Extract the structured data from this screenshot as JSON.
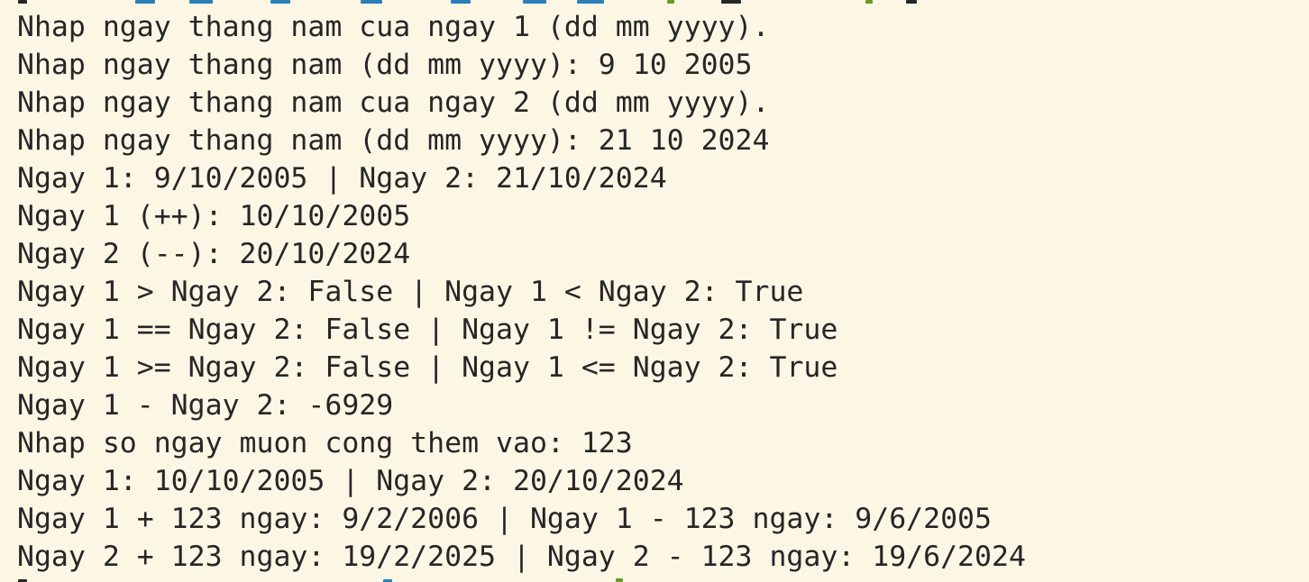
{
  "terminal": {
    "lines": [
      "Nhap ngay thang nam cua ngay 1 (dd mm yyyy).",
      "Nhap ngay thang nam (dd mm yyyy): 9 10 2005",
      "Nhap ngay thang nam cua ngay 2 (dd mm yyyy).",
      "Nhap ngay thang nam (dd mm yyyy): 21 10 2024",
      "Ngay 1: 9/10/2005 | Ngay 2: 21/10/2024",
      "Ngay 1 (++): 10/10/2005",
      "Ngay 2 (--): 20/10/2024",
      "Ngay 1 > Ngay 2: False | Ngay 1 < Ngay 2: True",
      "Ngay 1 == Ngay 2: False | Ngay 1 != Ngay 2: True",
      "Ngay 1 >= Ngay 2: False | Ngay 1 <= Ngay 2: True",
      "Ngay 1 - Ngay 2: -6929",
      "Nhap so ngay muon cong them vao: 123",
      "Ngay 1: 10/10/2005 | Ngay 2: 20/10/2024",
      "Ngay 1 + 123 ngay: 9/2/2006 | Ngay 1 - 123 ngay: 9/6/2005",
      "Ngay 2 + 123 ngay: 19/2/2025 | Ngay 2 - 123 ngay: 19/6/2024"
    ]
  },
  "colors": {
    "background": "#fcf6e4",
    "text": "#262626",
    "prompt_blue": "#2a7fb8",
    "prompt_green": "#6a9a1f"
  }
}
